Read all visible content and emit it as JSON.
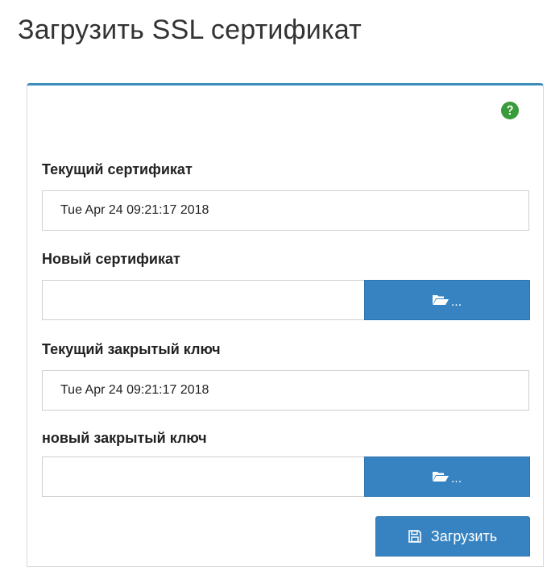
{
  "page": {
    "title": "Загрузить SSL сертификат"
  },
  "panel": {
    "help_icon": "question-circle-icon",
    "accent_color": "#3c8dbc"
  },
  "form": {
    "current_certificate": {
      "label": "Текущий сертификат",
      "value": "Tue Apr 24 09:21:17 2018"
    },
    "new_certificate": {
      "label": "Новый сертификат",
      "value": "",
      "browse_icon": "folder-open-icon",
      "browse_suffix": "..."
    },
    "current_private_key": {
      "label": "Текущий закрытый ключ",
      "value": "Tue Apr 24 09:21:17 2018"
    },
    "new_private_key": {
      "label": "новый закрытый ключ",
      "value": "",
      "browse_icon": "folder-open-icon",
      "browse_suffix": "..."
    },
    "submit": {
      "label": "Загрузить",
      "icon": "save-icon",
      "color": "#3783c1"
    }
  }
}
